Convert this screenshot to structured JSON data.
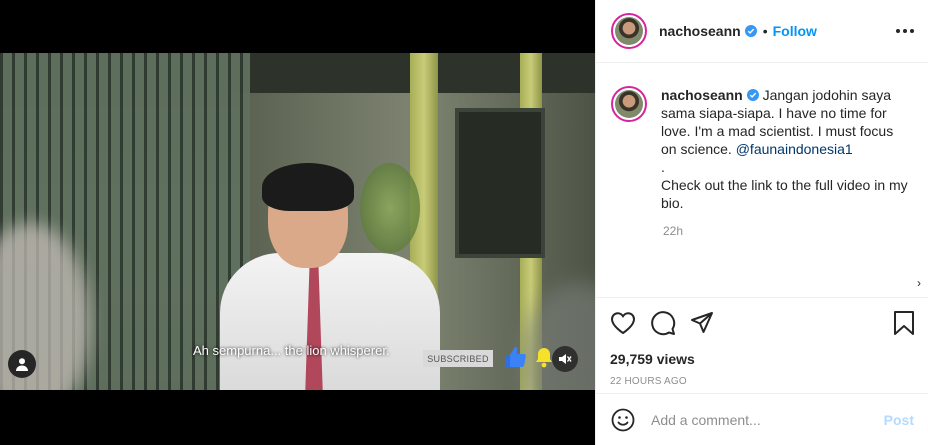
{
  "video": {
    "subtitle": "Ah sempurna... the lion whisperer.",
    "subscribed_label": "SUBSCRIBED"
  },
  "icons": {
    "user": "user-icon",
    "mute": "mute-icon",
    "thumbs_up": "thumbs-up-icon",
    "bell": "bell-icon",
    "verified": "verified-badge-icon",
    "more": "more-options-icon",
    "like": "heart-icon",
    "comment": "comment-icon",
    "share": "paper-plane-icon",
    "save": "bookmark-icon",
    "emoji": "emoji-icon"
  },
  "header": {
    "username": "nachoseann",
    "separator": "•",
    "follow_label": "Follow"
  },
  "post": {
    "caption_username": "nachoseann",
    "caption_text": " Jangan jodohin saya sama siapa-siapa. I have no time for love. I'm a mad scientist. I must focus on science. ",
    "mention": "@faunaindonesia1",
    "caption_dot": ".",
    "caption_tail": "Check out the link to the full video in my bio.",
    "relative_time": "22h",
    "views": "29,759 views",
    "posted_ago": "22 HOURS AGO"
  },
  "comment": {
    "placeholder": "Add a comment...",
    "post_label": "Post"
  },
  "colors": {
    "accent": "#0095f6",
    "verified": "#3897f0",
    "muted_text": "#8e8e8e",
    "post_disabled": "#b3dbff"
  }
}
